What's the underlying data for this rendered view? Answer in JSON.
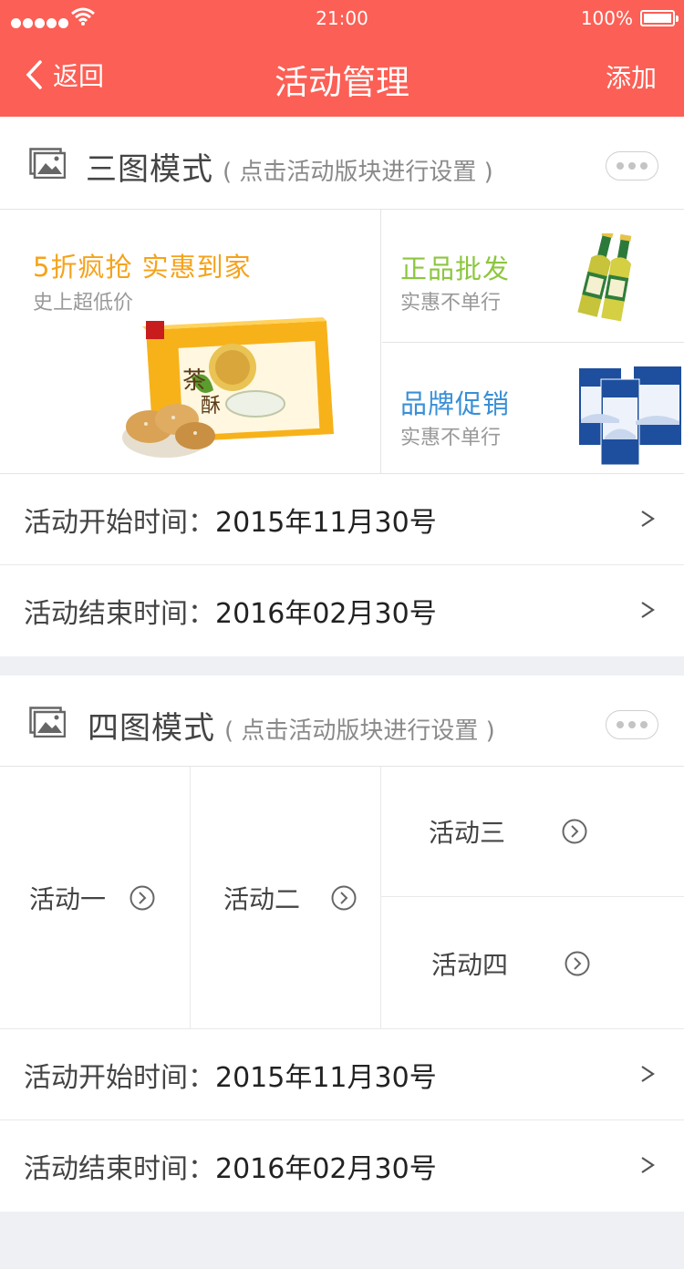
{
  "status_bar": {
    "time": "21:00",
    "battery": "100%"
  },
  "nav": {
    "back_label": "返回",
    "title": "活动管理",
    "add_label": "添加"
  },
  "three_mode": {
    "title": "三图模式",
    "hint": "( 点击活动版块进行设置 )",
    "main": {
      "title": "5折疯抢 实惠到家",
      "subtitle": "史上超低价",
      "title_color": "#f6a21a"
    },
    "top_right": {
      "title": "正品批发",
      "subtitle": "实惠不单行",
      "title_color": "#8cc63f"
    },
    "bottom_right": {
      "title": "品牌促销",
      "subtitle": "实惠不单行",
      "title_color": "#3a8fd6"
    },
    "start_label": "活动开始时间：",
    "start_value": "2015年11月30号",
    "end_label": "活动结束时间：",
    "end_value": "2016年02月30号"
  },
  "four_mode": {
    "title": "四图模式",
    "hint": "( 点击活动版块进行设置 )",
    "activities": [
      "活动一",
      "活动二",
      "活动三",
      "活动四"
    ],
    "start_label": "活动开始时间：",
    "start_value": "2015年11月30号",
    "end_label": "活动结束时间：",
    "end_value": "2016年02月30号"
  },
  "colors": {
    "header": "#fc5f55",
    "page_bg": "#eef0f3"
  }
}
